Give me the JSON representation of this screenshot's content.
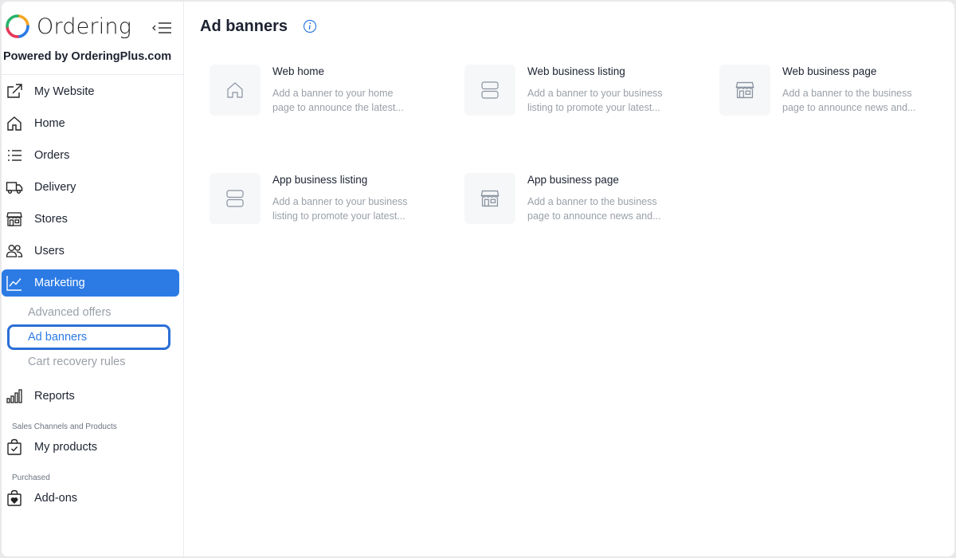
{
  "brand": {
    "name": "Ordering",
    "powered_by": "Powered by OrderingPlus.com"
  },
  "nav": {
    "items": [
      {
        "label": "My Website",
        "icon": "external-link-icon"
      },
      {
        "label": "Home",
        "icon": "home-icon"
      },
      {
        "label": "Orders",
        "icon": "list-icon"
      },
      {
        "label": "Delivery",
        "icon": "truck-icon"
      },
      {
        "label": "Stores",
        "icon": "store-icon"
      },
      {
        "label": "Users",
        "icon": "users-icon"
      },
      {
        "label": "Marketing",
        "icon": "chart-line-icon",
        "active": true
      },
      {
        "label": "Reports",
        "icon": "bar-chart-icon"
      },
      {
        "label": "My products",
        "icon": "bag-check-icon"
      },
      {
        "label": "Add-ons",
        "icon": "bag-heart-icon"
      }
    ],
    "marketing_sub": [
      {
        "label": "Advanced offers"
      },
      {
        "label": "Ad banners",
        "active": true
      },
      {
        "label": "Cart recovery rules"
      }
    ],
    "section_sales": "Sales Channels and Products",
    "section_purchased": "Purchased"
  },
  "page": {
    "title": "Ad banners"
  },
  "cards": [
    {
      "title": "Web home",
      "desc_line1": "Add a banner to your home",
      "desc_line2": "page to announce the latest...",
      "icon": "home-icon"
    },
    {
      "title": "Web business listing",
      "desc_line1": "Add a banner to your business",
      "desc_line2": "listing to promote your latest...",
      "icon": "listing-icon"
    },
    {
      "title": "Web business page",
      "desc_line1": "Add a banner to the business",
      "desc_line2": "page to announce news and...",
      "icon": "store-icon"
    },
    {
      "title": "App business listing",
      "desc_line1": "Add a banner to your business",
      "desc_line2": "listing to promote your latest...",
      "icon": "listing-icon"
    },
    {
      "title": "App business page",
      "desc_line1": "Add a banner to the business",
      "desc_line2": "page to announce news and...",
      "icon": "store-icon"
    }
  ],
  "colors": {
    "accent": "#2c7be5",
    "muted_text": "#9aa0a8",
    "thumb_bg": "#f6f7f9"
  }
}
